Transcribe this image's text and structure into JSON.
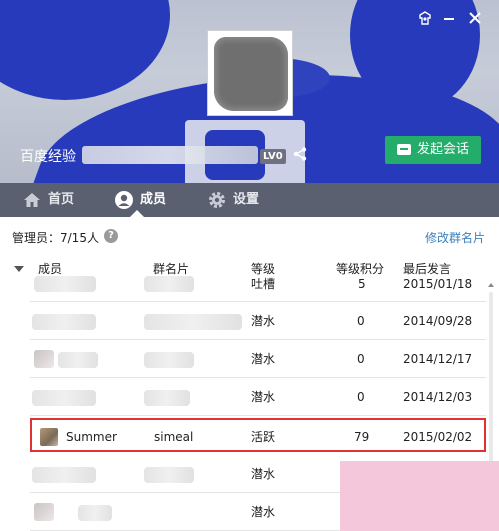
{
  "header": {
    "group_name": "百度经验",
    "level_badge": "LV0",
    "start_chat_label": "发起会话",
    "icons": [
      "skin-icon",
      "minimize-icon",
      "close-icon",
      "share-icon"
    ]
  },
  "tabs": [
    {
      "label": "首页",
      "icon": "home-icon"
    },
    {
      "label": "成员",
      "icon": "user-icon"
    },
    {
      "label": "设置",
      "icon": "gear-icon"
    }
  ],
  "admin": {
    "label": "管理员：7/15人",
    "help": "?",
    "edit_card_link": "修改群名片"
  },
  "table": {
    "headers": {
      "member": "成员",
      "card": "群名片",
      "level": "等级",
      "level_sub": "吐槽",
      "points": "等级积分",
      "last_post": "最后发言"
    },
    "rows": [
      {
        "member": "",
        "card": "",
        "level": "",
        "points": "5",
        "last_post": "2015/01/18"
      },
      {
        "member": "",
        "card": "",
        "level": "潜水",
        "points": "0",
        "last_post": "2014/09/28"
      },
      {
        "member": "",
        "card": "",
        "level": "潜水",
        "points": "0",
        "last_post": "2014/12/17"
      },
      {
        "member": "",
        "card": "",
        "level": "潜水",
        "points": "0",
        "last_post": "2014/12/03"
      },
      {
        "member": "Summer",
        "card": "simeal",
        "level": "活跃",
        "points": "79",
        "last_post": "2015/02/02"
      },
      {
        "member": "",
        "card": "",
        "level": "潜水",
        "points": "",
        "last_post": ""
      },
      {
        "member": "",
        "card": "",
        "level": "潜水",
        "points": "",
        "last_post": ""
      }
    ]
  },
  "colors": {
    "accent_green": "#24ad6a",
    "tab_bar": "#5a6070",
    "link": "#3a7fbf",
    "highlight_border": "#dd3333",
    "bg_blue": "#1f35c4"
  }
}
